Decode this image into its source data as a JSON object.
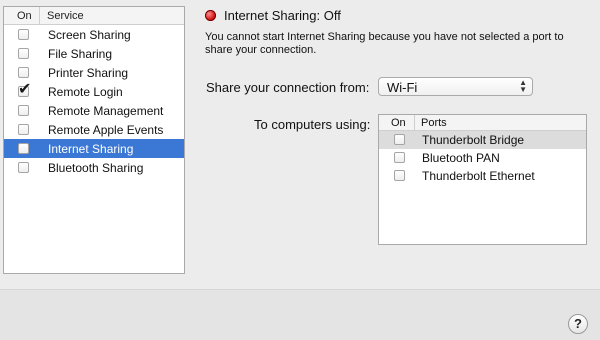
{
  "services": {
    "header_on": "On",
    "header_service": "Service",
    "items": [
      {
        "label": "Screen Sharing",
        "checked": false,
        "selected": false
      },
      {
        "label": "File Sharing",
        "checked": false,
        "selected": false
      },
      {
        "label": "Printer Sharing",
        "checked": false,
        "selected": false
      },
      {
        "label": "Remote Login",
        "checked": true,
        "selected": false
      },
      {
        "label": "Remote Management",
        "checked": false,
        "selected": false
      },
      {
        "label": "Remote Apple Events",
        "checked": false,
        "selected": false
      },
      {
        "label": "Internet Sharing",
        "checked": false,
        "selected": true
      },
      {
        "label": "Bluetooth Sharing",
        "checked": false,
        "selected": false
      }
    ]
  },
  "status": {
    "title": "Internet Sharing: Off",
    "description": "You cannot start Internet Sharing because you have not selected a port to share your connection.",
    "indicator_color": "#d01414"
  },
  "share_from": {
    "label": "Share your connection from:",
    "value": "Wi-Fi"
  },
  "to_computers": {
    "label": "To computers using:",
    "header_on": "On",
    "header_ports": "Ports",
    "ports": [
      {
        "label": "Thunderbolt Bridge",
        "checked": false,
        "selected": true
      },
      {
        "label": "Bluetooth PAN",
        "checked": false,
        "selected": false
      },
      {
        "label": "Thunderbolt Ethernet",
        "checked": false,
        "selected": false
      }
    ]
  },
  "help": {
    "label": "?"
  },
  "colors": {
    "selection": "#3b77d4",
    "background": "#ececec"
  }
}
